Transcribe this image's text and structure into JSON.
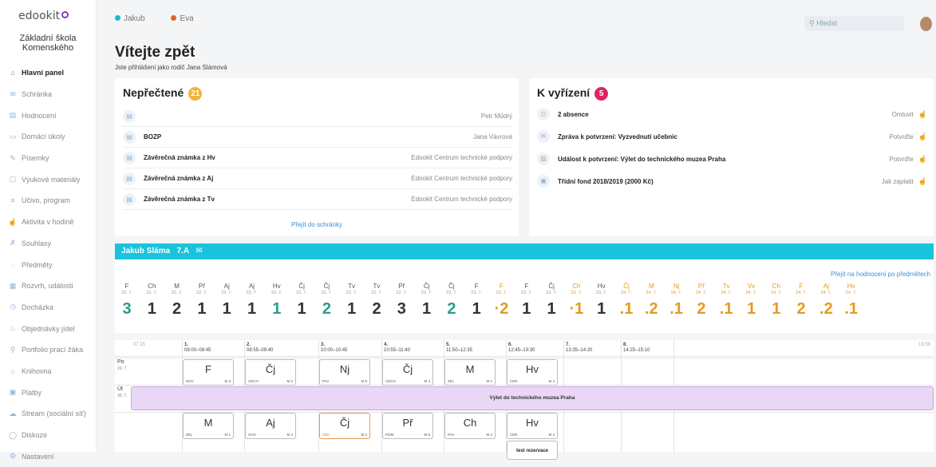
{
  "brand": {
    "logo": "edookit",
    "school": "Základní škola Komenského"
  },
  "nav": [
    {
      "icon": "home-icon",
      "glyph": "⌂",
      "label": "Hlavní panel",
      "active": true
    },
    {
      "icon": "mail-icon",
      "glyph": "✉",
      "label": "Schránka"
    },
    {
      "icon": "grade-icon",
      "glyph": "▤",
      "label": "Hodnocení"
    },
    {
      "icon": "homework-icon",
      "glyph": "▭",
      "label": "Domácí úkoly"
    },
    {
      "icon": "test-icon",
      "glyph": "✎",
      "label": "Písemky"
    },
    {
      "icon": "material-icon",
      "glyph": "▢",
      "label": "Výukové materiály"
    },
    {
      "icon": "curriculum-icon",
      "glyph": "≡",
      "label": "Učivo, program"
    },
    {
      "icon": "activity-icon",
      "glyph": "☝",
      "label": "Aktivita v hodině"
    },
    {
      "icon": "consent-icon",
      "glyph": "✗",
      "label": "Souhlasy"
    },
    {
      "icon": "subjects-icon",
      "glyph": "◌",
      "label": "Předměty"
    },
    {
      "icon": "schedule-icon",
      "glyph": "▦",
      "label": "Rozvrh, události"
    },
    {
      "icon": "attendance-icon",
      "glyph": "◷",
      "label": "Docházka"
    },
    {
      "icon": "meals-icon",
      "glyph": "♨",
      "label": "Objednávky jídel"
    },
    {
      "icon": "portfolio-icon",
      "glyph": "⚲",
      "label": "Portfolio prací žáka"
    },
    {
      "icon": "library-icon",
      "glyph": "⌂",
      "label": "Knihovna"
    },
    {
      "icon": "payments-icon",
      "glyph": "▣",
      "label": "Platby"
    },
    {
      "icon": "stream-icon",
      "glyph": "☁",
      "label": "Stream (sociální síť)"
    },
    {
      "icon": "discussion-icon",
      "glyph": "◯",
      "label": "Diskuze"
    },
    {
      "icon": "settings-icon",
      "glyph": "⚙",
      "label": "Nastavení"
    }
  ],
  "topbar": {
    "child1": "Jakub",
    "child2": "Eva",
    "search_placeholder": "Hledat"
  },
  "welcome": {
    "title": "Vítejte zpět",
    "subtitle": "Jste přihlášeni jako rodič Jana Slámová"
  },
  "unread": {
    "title": "Nepřečtené",
    "count": "21",
    "link": "Přejít do schránky",
    "rows": [
      {
        "title": "",
        "from": "Petr Műdrý"
      },
      {
        "title": "BOZP",
        "from": "Jana Vávrová"
      },
      {
        "title": "Závěrečná známka z Hv",
        "from": "Edookit Centrum technické podpory"
      },
      {
        "title": "Závěrečná známka z Aj",
        "from": "Edookit Centrum technické podpory"
      },
      {
        "title": "Závěrečná známka z Tv",
        "from": "Edookit Centrum technické podpory"
      }
    ]
  },
  "todo": {
    "title": "K vyřízení",
    "count": "5",
    "rows": [
      {
        "title": "2 absence",
        "action": "Omluvit"
      },
      {
        "title": "Zpráva k potvrzení: Vyzvednutí učebnic",
        "action": "Potvrďte"
      },
      {
        "title": "Událost k potvrzení: Výlet do technického muzea Praha",
        "action": "Potvrďte"
      },
      {
        "title": "Třídní fond 2018/2019 (2000 Kč)",
        "action": "Jak zaplatit"
      }
    ]
  },
  "student": {
    "name": "Jakub Sláma",
    "class": "7.A"
  },
  "grades": {
    "link": "Přejít na hodnocení po předmětech",
    "items": [
      {
        "s": "F",
        "d": "22. 7.",
        "g": "3",
        "c": "g"
      },
      {
        "s": "Ch",
        "d": "22. 7.",
        "g": "1"
      },
      {
        "s": "M",
        "d": "22. 7.",
        "g": "2"
      },
      {
        "s": "Př",
        "d": "22. 7.",
        "g": "1"
      },
      {
        "s": "Aj",
        "d": "22. 7.",
        "g": "1"
      },
      {
        "s": "Aj",
        "d": "22. 7.",
        "g": "1"
      },
      {
        "s": "Hv",
        "d": "22. 7.",
        "g": "1",
        "c": "g"
      },
      {
        "s": "Čj",
        "d": "22. 7.",
        "g": "1"
      },
      {
        "s": "Čj",
        "d": "22. 7.",
        "g": "2",
        "c": "g"
      },
      {
        "s": "Tv",
        "d": "22. 7.",
        "g": "1"
      },
      {
        "s": "Tv",
        "d": "22. 7.",
        "g": "2"
      },
      {
        "s": "Př",
        "d": "22. 7.",
        "g": "3"
      },
      {
        "s": "Čj",
        "d": "23. 7.",
        "g": "1"
      },
      {
        "s": "Čj",
        "d": "23. 7.",
        "g": "2",
        "c": "g"
      },
      {
        "s": "F",
        "d": "23. 7.",
        "g": "1"
      },
      {
        "s": "F",
        "d": "23. 7.",
        "g": "·2",
        "c": "o"
      },
      {
        "s": "F",
        "d": "23. 7.",
        "g": "1"
      },
      {
        "s": "Čj",
        "d": "23. 7.",
        "g": "1"
      },
      {
        "s": "Ch",
        "d": "23. 7.",
        "g": "·1",
        "c": "o"
      },
      {
        "s": "Hv",
        "d": "23. 7.",
        "g": "1"
      },
      {
        "s": "Čj",
        "d": "24. 7.",
        "g": ".1",
        "c": "o"
      },
      {
        "s": "M",
        "d": "24. 7.",
        "g": ".2",
        "c": "o"
      },
      {
        "s": "Nj",
        "d": "24. 7.",
        "g": ".1",
        "c": "o"
      },
      {
        "s": "Př",
        "d": "24. 7.",
        "g": "2",
        "c": "o"
      },
      {
        "s": "Tv",
        "d": "24. 7.",
        "g": ".1",
        "c": "o"
      },
      {
        "s": "Vv",
        "d": "24. 7.",
        "g": "1",
        "c": "o"
      },
      {
        "s": "Ch",
        "d": "24. 7.",
        "g": "1",
        "c": "o"
      },
      {
        "s": "F",
        "d": "24. 7.",
        "g": "2",
        "c": "o"
      },
      {
        "s": "Aj",
        "d": "24. 7.",
        "g": ".2",
        "c": "o"
      },
      {
        "s": "Hv",
        "d": "24. 7.",
        "g": ".1",
        "c": "o"
      }
    ]
  },
  "timetable": {
    "start": "07:15",
    "end": "18:59",
    "periods": [
      {
        "n": "1.",
        "t": "08:00–08:45"
      },
      {
        "n": "2.",
        "t": "08:55–09:40"
      },
      {
        "n": "3.",
        "t": "10:00–10:45"
      },
      {
        "n": "4.",
        "t": "10:55–11:40"
      },
      {
        "n": "5.",
        "t": "11:50–12:35"
      },
      {
        "n": "6.",
        "t": "12:45–13:30"
      },
      {
        "n": "7.",
        "t": "13:35–14:20"
      },
      {
        "n": "8.",
        "t": "14:25–15:10"
      }
    ],
    "days": [
      {
        "name": "Po",
        "date": "29. 7."
      },
      {
        "name": "Út",
        "date": "30. 7."
      }
    ],
    "monday": [
      {
        "s": "F",
        "t": "NOV",
        "r": "M 3"
      },
      {
        "s": "Čj",
        "t": "CECH",
        "r": "M 2"
      },
      {
        "s": "Nj",
        "t": "PAV",
        "r": "M 5"
      },
      {
        "s": "Čj",
        "t": "CECH",
        "r": "M 4"
      },
      {
        "s": "M",
        "t": "ZEL",
        "r": "M 1"
      },
      {
        "s": "Hv",
        "t": "CER",
        "r": "M 4"
      }
    ],
    "event": "Výlet do technického muzea Praha",
    "tuesday": [
      {
        "s": "M",
        "t": "ZEL",
        "r": "M 1"
      },
      {
        "s": "Aj",
        "t": "SVO",
        "r": "M 4"
      },
      {
        "s": "Čj",
        "t": "CEK",
        "r": "M 2"
      },
      {
        "s": "Př",
        "t": "POM",
        "r": "M 5"
      },
      {
        "s": "Ch",
        "t": "PAV",
        "r": "M 2"
      },
      {
        "s": "Hv",
        "t": "CER",
        "r": "M 4"
      }
    ],
    "extra": "test rezervace"
  }
}
